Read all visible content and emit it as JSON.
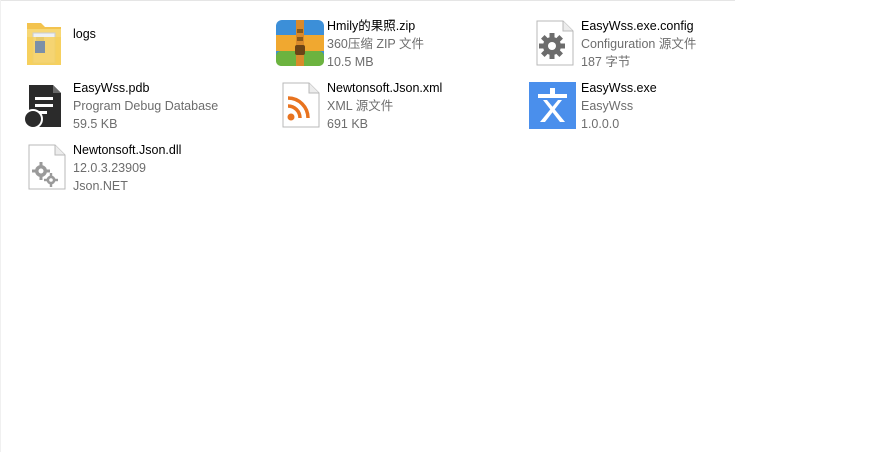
{
  "files": [
    {
      "name": "logs",
      "line2": "",
      "line3": "",
      "icon": "folder-icon"
    },
    {
      "name": "Hmily的果照.zip",
      "line2": "360压缩 ZIP 文件",
      "line3": "10.5 MB",
      "icon": "zip-archive-icon"
    },
    {
      "name": "EasyWss.exe.config",
      "line2": "Configuration 源文件",
      "line3": "187 字节",
      "icon": "config-gear-icon"
    },
    {
      "name": "EasyWss.pdb",
      "line2": "Program Debug Database",
      "line3": "59.5 KB",
      "icon": "pdb-document-icon"
    },
    {
      "name": "Newtonsoft.Json.xml",
      "line2": "XML 源文件",
      "line3": "691 KB",
      "icon": "xml-rss-icon"
    },
    {
      "name": "EasyWss.exe",
      "line2": "EasyWss",
      "line3": "1.0.0.0",
      "icon": "app-wen-icon"
    },
    {
      "name": "Newtonsoft.Json.dll",
      "line2": "12.0.3.23909",
      "line3": "Json.NET",
      "icon": "dll-gears-icon"
    }
  ],
  "colors": {
    "app_icon_bg": "#4a8fec",
    "rss_orange": "#e8731f",
    "folder_yellow": "#f1c34f"
  }
}
